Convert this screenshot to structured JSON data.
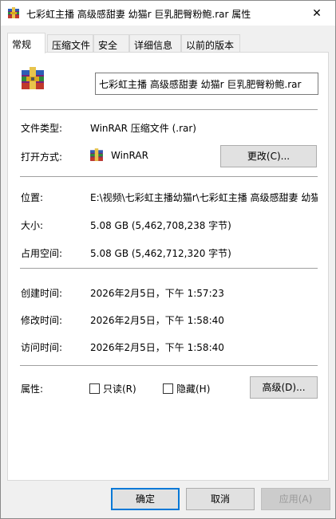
{
  "window": {
    "title": "七彩虹主播 高级感甜妻 幼猫r  巨乳肥臀粉鲍.rar 属性",
    "close_glyph": "✕"
  },
  "tabs": [
    {
      "label": "常规",
      "active": true
    },
    {
      "label": "压缩文件",
      "active": false
    },
    {
      "label": "安全",
      "active": false
    },
    {
      "label": "详细信息",
      "active": false
    },
    {
      "label": "以前的版本",
      "active": false
    }
  ],
  "general": {
    "file_name": "七彩虹主播 高级感甜妻 幼猫r  巨乳肥臀粉鲍.rar",
    "type_label": "文件类型:",
    "type_value": "WinRAR 压缩文件 (.rar)",
    "opens_label": "打开方式:",
    "opens_value": "WinRAR",
    "change_button": "更改(C)...",
    "location_label": "位置:",
    "location_value": "E:\\视频\\七彩虹主播幼猫r\\七彩虹主播 高级感甜妻 幼猫",
    "size_label": "大小:",
    "size_value": "5.08 GB (5,462,708,238 字节)",
    "disk_label": "占用空间:",
    "disk_value": "5.08 GB (5,462,712,320 字节)",
    "created_label": "创建时间:",
    "created_value": "2026年2月5日，下午 1:57:23",
    "modified_label": "修改时间:",
    "modified_value": "2026年2月5日，下午 1:58:40",
    "accessed_label": "访问时间:",
    "accessed_value": "2026年2月5日，下午 1:58:40",
    "attributes_label": "属性:",
    "readonly_label": "只读(R)",
    "hidden_label": "隐藏(H)",
    "advanced_button": "高级(D)..."
  },
  "footer": {
    "ok": "确定",
    "cancel": "取消",
    "apply": "应用(A)"
  },
  "icons": {
    "title": "winrar-archive-icon",
    "file": "winrar-archive-icon",
    "app": "winrar-app-icon"
  },
  "colors": {
    "focus_border": "#0078d7",
    "panel_bg": "#ffffff",
    "window_bg": "#f0f0f0"
  }
}
